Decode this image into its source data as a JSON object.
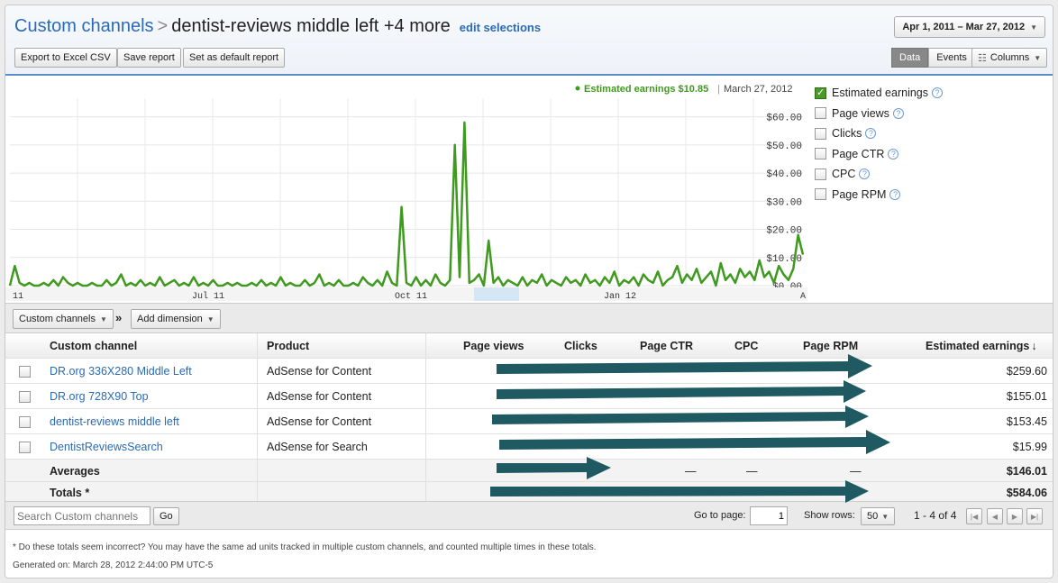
{
  "header": {
    "breadcrumb_root": "Custom channels",
    "separator": ">",
    "current": "dentist-reviews middle left +4 more",
    "edit_link": "edit selections",
    "date_range": "Apr 1, 2011 – Mar 27, 2012",
    "buttons": {
      "export": "Export to Excel CSV",
      "save": "Save report",
      "default": "Set as default report"
    },
    "view_toggle": {
      "data": "Data",
      "events": "Events",
      "columns": "Columns"
    }
  },
  "chart_data": {
    "type": "line",
    "legend_text": "Estimated earnings",
    "legend_value": "$10.85",
    "legend_date": "March 27, 2012",
    "y_ticks": [
      "$0.00",
      "$10.00",
      "$20.00",
      "$30.00",
      "$40.00",
      "$50.00",
      "$60.00"
    ],
    "ylim": [
      0,
      65
    ],
    "x_tick_labels": [
      "11",
      "Jul 11",
      "Oct 11",
      "Jan 12",
      "A"
    ],
    "series": [
      {
        "color": "#3f9a1f",
        "values": [
          0,
          7,
          1,
          0,
          1,
          0,
          0,
          1,
          0,
          2,
          0,
          3,
          1,
          0,
          1,
          0,
          0,
          1,
          0,
          0,
          2,
          0,
          1,
          4,
          0,
          1,
          0,
          2,
          0,
          1,
          0,
          3,
          0,
          1,
          2,
          0,
          1,
          0,
          3,
          0,
          1,
          0,
          2,
          0,
          0,
          1,
          0,
          1,
          0,
          0,
          1,
          0,
          2,
          0,
          1,
          0,
          3,
          0,
          1,
          0,
          0,
          2,
          0,
          1,
          4,
          0,
          1,
          0,
          2,
          0,
          0,
          1,
          0,
          3,
          1,
          0,
          2,
          0,
          5,
          1,
          0,
          28,
          1,
          0,
          3,
          0,
          2,
          0,
          4,
          1,
          0,
          2,
          50,
          3,
          58,
          1,
          2,
          4,
          0,
          16,
          1,
          3,
          0,
          2,
          1,
          0,
          3,
          0,
          2,
          1,
          4,
          0,
          2,
          1,
          0,
          3,
          1,
          2,
          0,
          4,
          1,
          2,
          0,
          3,
          1,
          5,
          0,
          2,
          1,
          3,
          0,
          4,
          2,
          1,
          5,
          0,
          2,
          3,
          7,
          1,
          4,
          2,
          6,
          1,
          3,
          5,
          0,
          8,
          2,
          4,
          1,
          6,
          3,
          5,
          2,
          9,
          3,
          5,
          1,
          7,
          4,
          2,
          6,
          18,
          11
        ]
      }
    ]
  },
  "metrics": [
    {
      "label": "Estimated earnings",
      "checked": true
    },
    {
      "label": "Page views",
      "checked": false
    },
    {
      "label": "Clicks",
      "checked": false
    },
    {
      "label": "Page CTR",
      "checked": false
    },
    {
      "label": "CPC",
      "checked": false
    },
    {
      "label": "Page RPM",
      "checked": false
    }
  ],
  "dim_bar": {
    "custom_channels": "Custom channels",
    "arrow": "»",
    "add_dimension": "Add dimension"
  },
  "table": {
    "columns": [
      "Custom channel",
      "Product",
      "Page views",
      "Clicks",
      "Page CTR",
      "CPC",
      "Page RPM",
      "Estimated earnings"
    ],
    "sort_indicator": "↓",
    "rows": [
      {
        "channel": "DR.org 336X280 Middle Left",
        "product": "AdSense for Content",
        "earnings": "$259.60"
      },
      {
        "channel": "DR.org 728X90 Top",
        "product": "AdSense for Content",
        "earnings": "$155.01"
      },
      {
        "channel": "dentist-reviews middle left",
        "product": "AdSense for Content",
        "earnings": "$153.45"
      },
      {
        "channel": "DentistReviewsSearch",
        "product": "AdSense for Search",
        "earnings": "$15.99"
      }
    ],
    "averages": {
      "label": "Averages",
      "ctr": "—",
      "cpc": "—",
      "rpm": "—",
      "earnings": "$146.01"
    },
    "totals": {
      "label": "Totals *",
      "earnings": "$584.06"
    }
  },
  "footer": {
    "search_placeholder": "Search Custom channels",
    "go": "Go",
    "goto_label": "Go to page:",
    "goto_value": "1",
    "show_rows_label": "Show rows:",
    "show_rows_value": "50",
    "range": "1 - 4 of 4",
    "note": "* Do these totals seem incorrect? You may have the same ad units tracked in multiple custom channels, and counted multiple times in these totals.",
    "generated": "Generated on: March 28, 2012 2:44:00 PM UTC-5"
  }
}
